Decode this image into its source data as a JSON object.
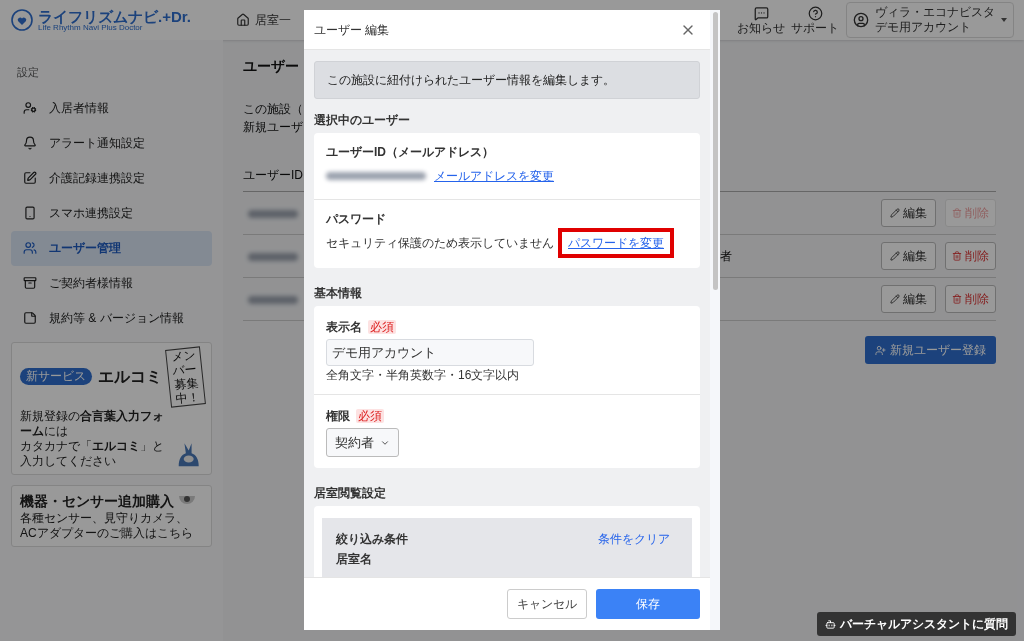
{
  "header": {
    "logo": {
      "name": "ライフリズムナビ.+Dr.",
      "tagline": "Life Rhythm Navi Plus Doctor"
    },
    "nav_link": "居室一",
    "icons": [
      {
        "kind": "notice",
        "label": "お知らせ"
      },
      {
        "kind": "support",
        "label": "サポート"
      }
    ],
    "account": {
      "facility": "ヴィラ・エコナビスタ",
      "name": "デモ用アカウント"
    }
  },
  "sidebar": {
    "section_title": "設定",
    "items": [
      {
        "kind": "resident",
        "label": "入居者情報",
        "selected": false
      },
      {
        "kind": "alert",
        "label": "アラート通知設定",
        "selected": false
      },
      {
        "kind": "care",
        "label": "介護記録連携設定",
        "selected": false
      },
      {
        "kind": "phone",
        "label": "スマホ連携設定",
        "selected": false
      },
      {
        "kind": "users",
        "label": "ユーザー管理",
        "selected": true
      },
      {
        "kind": "contract",
        "label": "ご契約者様情報",
        "selected": false
      },
      {
        "kind": "terms",
        "label": "規約等 & バージョン情報",
        "selected": false
      }
    ],
    "banners": {
      "elcomi": {
        "badge": "新サービス",
        "title": "エルコミ",
        "lines": [
          "新規登録の**合言葉入力フォーム**には",
          "カタカナで「**エルコミ**」と入力してください"
        ],
        "sign": "メンバー募集中！"
      },
      "purchase": {
        "title": "機器・センサー追加購入",
        "text": "各種センサー、見守りカメラ、ACアダプターのご購入はこちら"
      }
    }
  },
  "main": {
    "title": "ユーザー",
    "description": [
      "この施設（",
      "新規ユーザ"
    ],
    "columns": [
      "ユーザーID"
    ],
    "rows": [
      {
        "edit": "編集",
        "delete": "削除",
        "delete_disabled": true
      },
      {
        "column_2": "者",
        "edit": "編集",
        "delete": "削除",
        "delete_disabled": false
      },
      {
        "edit": "編集",
        "delete": "削除",
        "delete_disabled": false
      }
    ],
    "new_user_button": "新規ユーザー登録"
  },
  "assistant_button": "バーチャルアシスタントに質問",
  "modal": {
    "title": "ユーザー 編集",
    "notice": "この施設に紐付けられたユーザー情報を編集します。",
    "selected_user": {
      "heading": "選択中のユーザー",
      "id_label": "ユーザーID（メールアドレス）",
      "change_email": "メールアドレスを変更",
      "password_label": "パスワード",
      "password_text": "セキュリティ保護のため表示していません",
      "change_password": "パスワードを変更",
      "change_password_highlighted": true
    },
    "basic_info": {
      "heading": "基本情報",
      "display_name": {
        "label": "表示名",
        "required": "必須",
        "value": "デモ用アカウント",
        "hint": "全角文字・半角英数字・16文字以内"
      },
      "role": {
        "label": "権限",
        "required": "必須",
        "value": "契約者"
      }
    },
    "room_view": {
      "heading": "居室閲覧設定",
      "filter_title": "絞り込み条件",
      "clear": "条件をクリア",
      "room_name": "居室名"
    },
    "cancel": "キャンセル",
    "save": "保存"
  }
}
